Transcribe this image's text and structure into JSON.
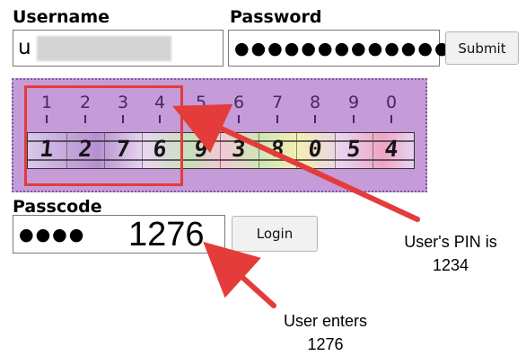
{
  "login": {
    "username_label": "Username",
    "username_value": "u",
    "password_label": "Password",
    "password_masked": "●●●●●●●●●●●●●",
    "submit_label": "Submit"
  },
  "pin_strip": {
    "positions": [
      "1",
      "2",
      "3",
      "4",
      "5",
      "6",
      "7",
      "8",
      "9",
      "0"
    ],
    "digits": [
      "1",
      "2",
      "7",
      "6",
      "9",
      "3",
      "8",
      "0",
      "5",
      "4"
    ]
  },
  "passcode": {
    "label": "Passcode",
    "masked": "●●●●",
    "entered": "1276",
    "login_label": "Login"
  },
  "annotations": {
    "pin_note_line1": "User's PIN is",
    "pin_note_line2": "1234",
    "enter_note_line1": "User enters",
    "enter_note_line2": "1276"
  },
  "colors": {
    "highlight": "#e43b3b",
    "panel": "#c59bd8"
  }
}
